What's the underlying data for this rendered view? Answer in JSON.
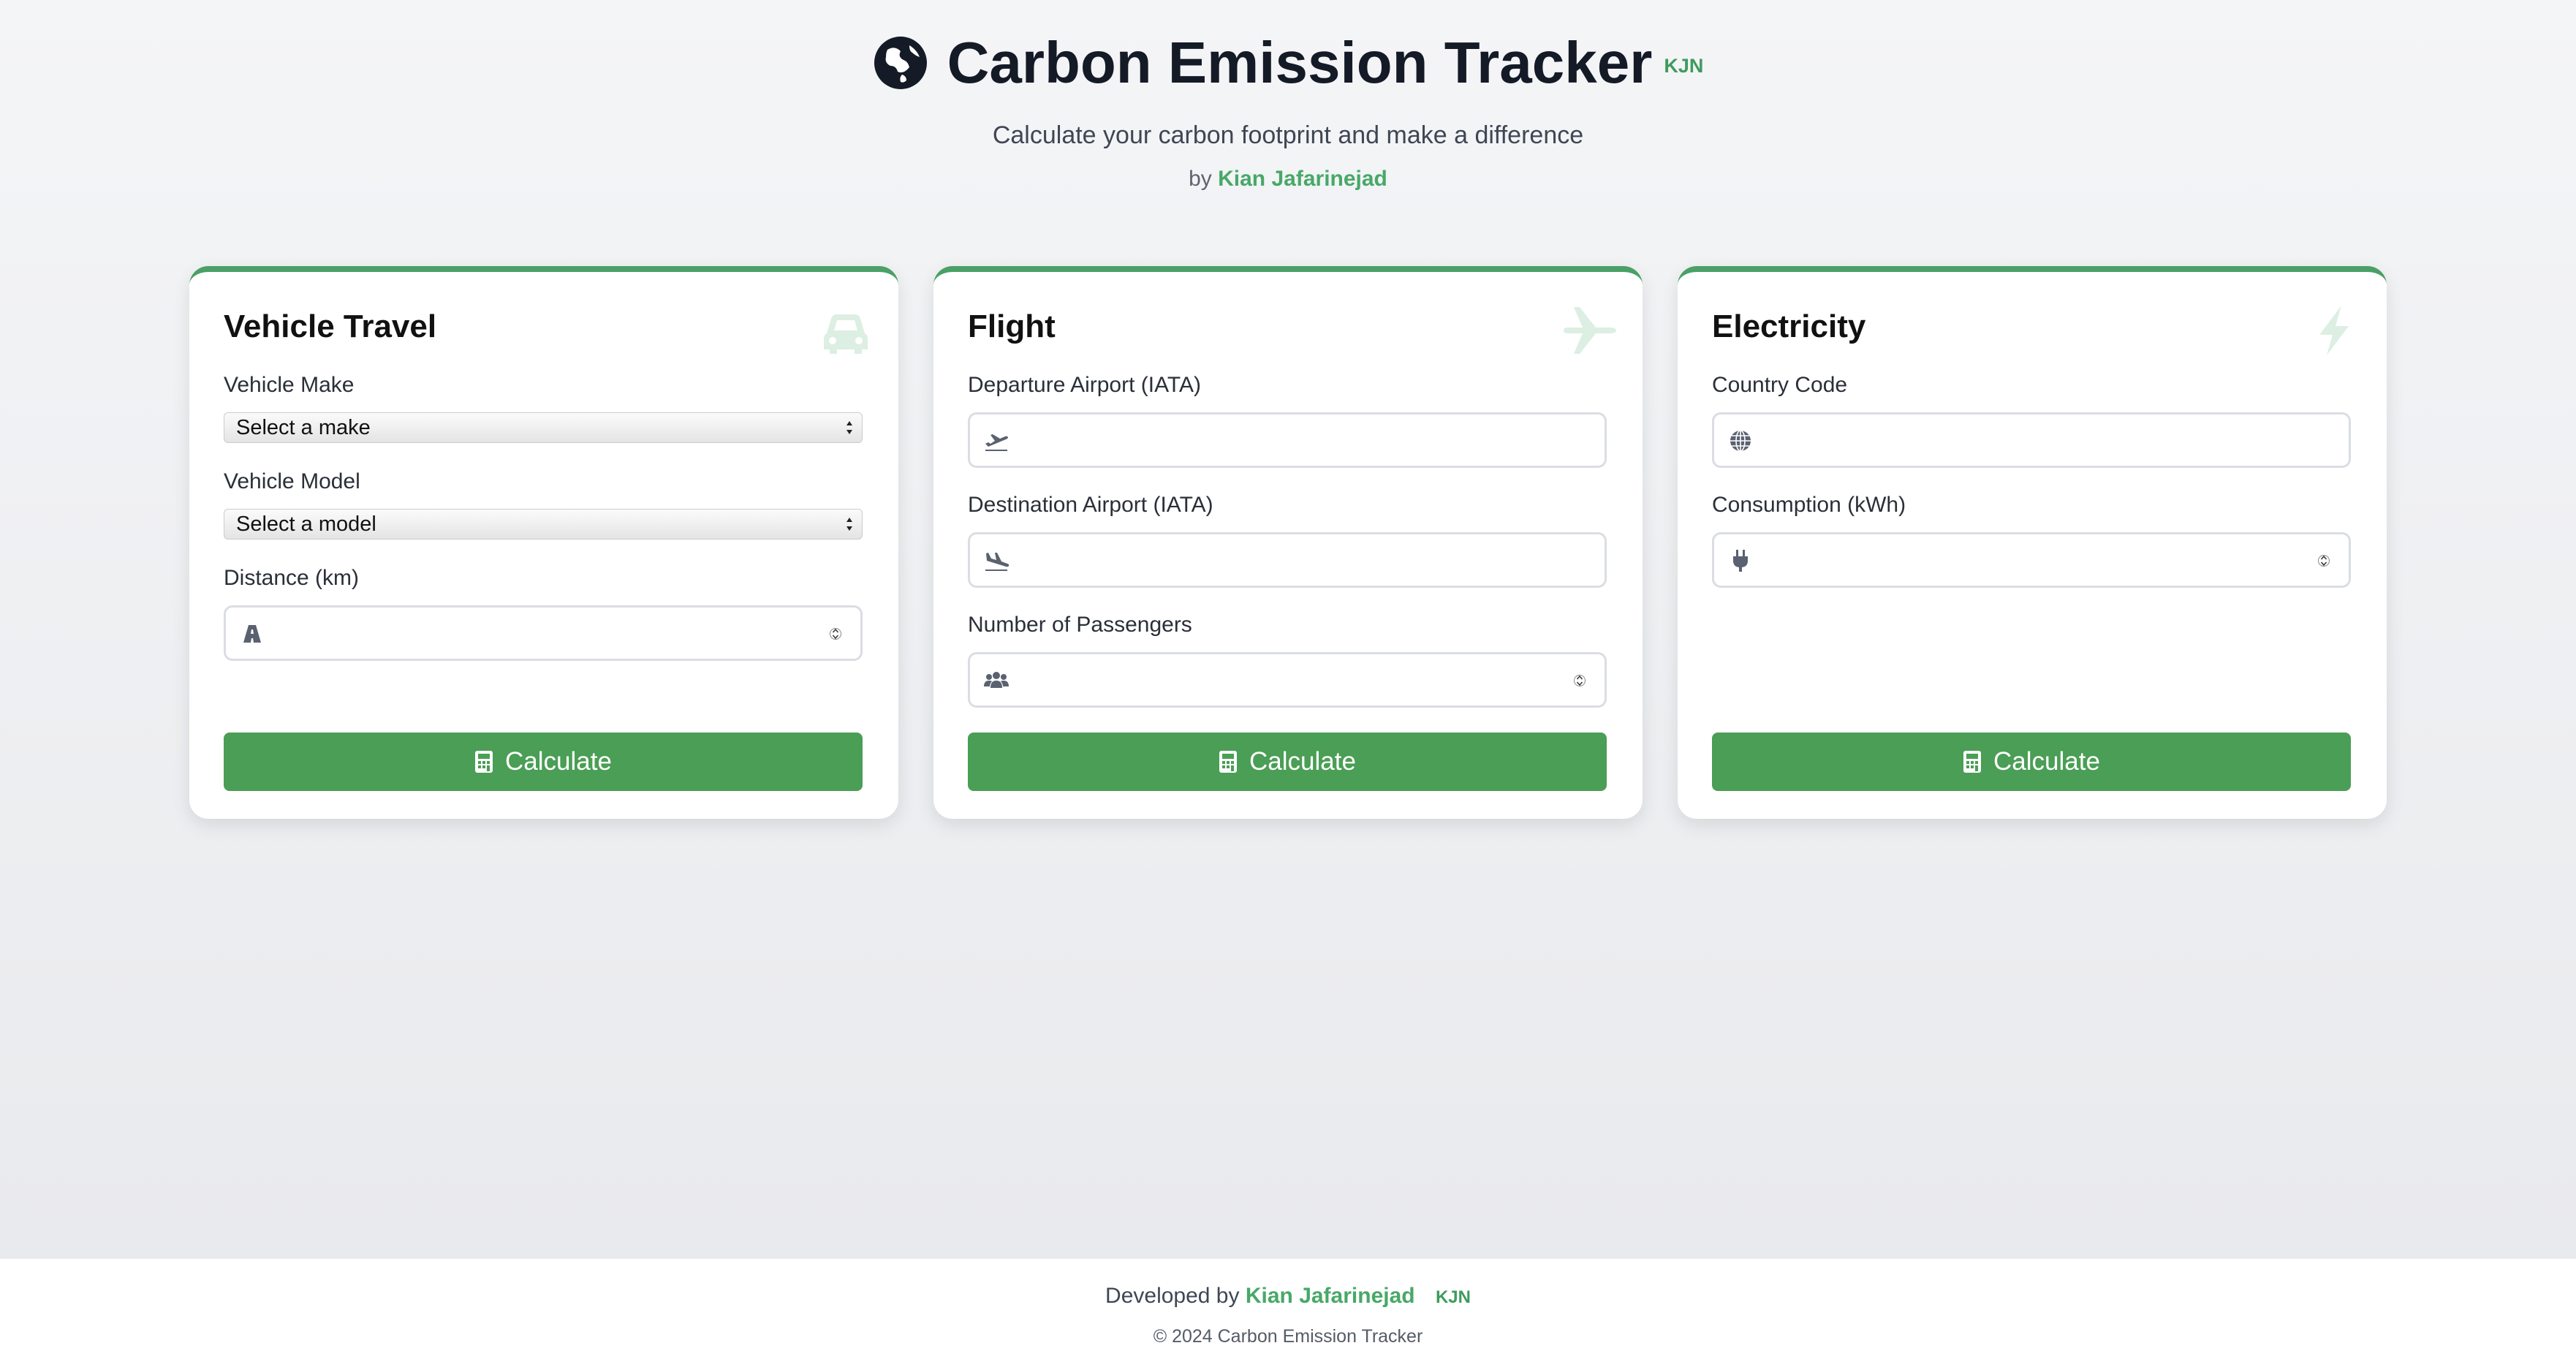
{
  "header": {
    "title": "Carbon Emission Tracker",
    "badge": "KJN",
    "subtitle": "Calculate your carbon footprint and make a difference",
    "by_prefix": "by",
    "author": "Kian Jafarinejad",
    "logo_icon": "globe-icon"
  },
  "colors": {
    "accent": "#4a9e55",
    "brand_text": "#48a868",
    "title": "#141a26"
  },
  "cards": {
    "vehicle": {
      "title": "Vehicle Travel",
      "icon": "car-icon",
      "make_label": "Vehicle Make",
      "make_value": "Select a make",
      "model_label": "Vehicle Model",
      "model_value": "Select a model",
      "distance_label": "Distance (km)",
      "distance_value": "",
      "button": "Calculate"
    },
    "flight": {
      "title": "Flight",
      "icon": "plane-icon",
      "departure_label": "Departure Airport (IATA)",
      "departure_value": "",
      "destination_label": "Destination Airport (IATA)",
      "destination_value": "",
      "passengers_label": "Number of Passengers",
      "passengers_value": "",
      "button": "Calculate"
    },
    "electricity": {
      "title": "Electricity",
      "icon": "bolt-icon",
      "country_label": "Country Code",
      "country_value": "",
      "consumption_label": "Consumption (kWh)",
      "consumption_value": "",
      "button": "Calculate"
    }
  },
  "footer": {
    "developed_prefix": "Developed by",
    "author": "Kian Jafarinejad",
    "badge": "KJN",
    "copyright": "© 2024 Carbon Emission Tracker"
  }
}
